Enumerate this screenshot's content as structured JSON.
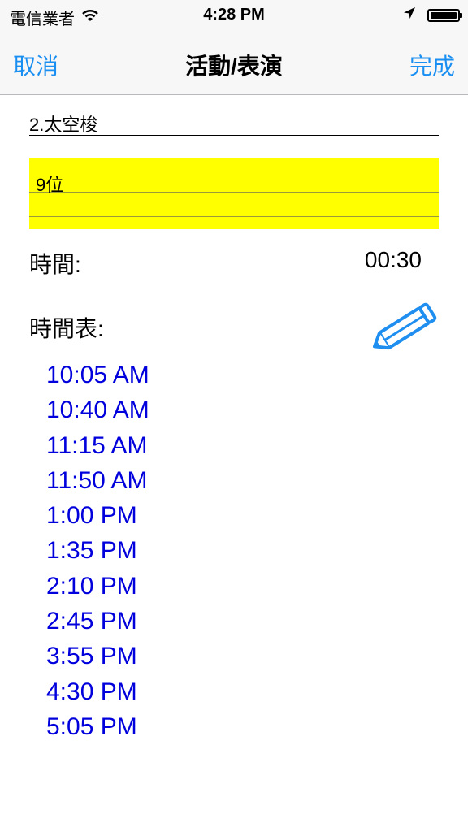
{
  "status_bar": {
    "carrier": "電信業者",
    "time": "4:28 PM",
    "battery_level": 1.0,
    "icons": [
      "wifi-icon",
      "location-arrow-icon",
      "battery-icon"
    ]
  },
  "nav": {
    "left": "取消",
    "title": "活動/表演",
    "right": "完成"
  },
  "form": {
    "name_value": "2.太空梭",
    "notes_text": "9位",
    "time_label": "時間:",
    "time_value": "00:30",
    "schedule_label": "時間表:",
    "edit_icon": "pencil-icon"
  },
  "schedule": [
    "10:05 AM",
    "10:40 AM",
    "11:15 AM",
    "11:50 AM",
    "1:00 PM",
    "1:35 PM",
    "2:10 PM",
    "2:45 PM",
    "3:55 PM",
    "4:30 PM",
    "5:05 PM"
  ],
  "colors": {
    "accent": "#1a8ff2",
    "schedule_text": "#0000dd",
    "notes_background": "#ffff00"
  }
}
